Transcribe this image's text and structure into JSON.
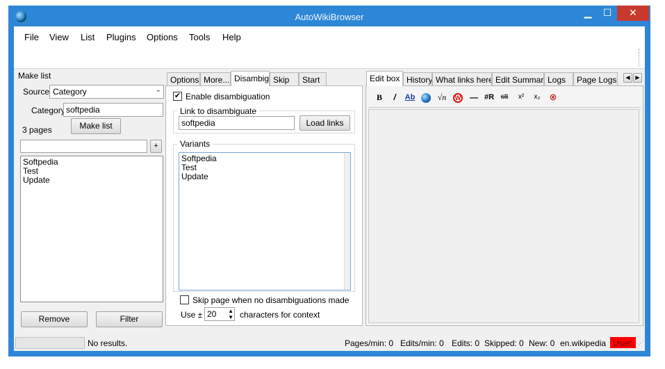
{
  "window": {
    "title": "AutoWikiBrowser"
  },
  "menu": [
    "File",
    "View",
    "List",
    "Plugins",
    "Options",
    "Tools",
    "Help"
  ],
  "make_list": {
    "heading": "Make list",
    "source_label": "Source:",
    "source_value": "Category",
    "category_label": "Category:",
    "category_value": "softpedia",
    "pages_count": "3 pages",
    "make_list_button": "Make list",
    "add_button": "+",
    "filter_input": "",
    "items": [
      "Softpedia",
      "Test",
      "Update"
    ],
    "remove_button": "Remove",
    "filter_button": "Filter"
  },
  "middle_tabs": [
    "Options",
    "More...",
    "Disambig",
    "Skip",
    "Start"
  ],
  "disambig": {
    "enable_label": "Enable disambiguation",
    "enable_checked": true,
    "link_group": "Link to disambiguate",
    "link_value": "softpedia",
    "load_links_button": "Load links",
    "variants_group": "Variants",
    "variants": [
      "Softpedia",
      "Test",
      "Update"
    ],
    "skip_label": "Skip page when no disambiguations made",
    "skip_checked": false,
    "use_label": "Use ±",
    "context_value": "20",
    "context_suffix": "characters for context"
  },
  "right_tabs": [
    "Edit box",
    "History",
    "What links here",
    "Edit Summary",
    "Logs",
    "Page Logs"
  ],
  "edit_toolbar": {
    "bold": "B",
    "italic": "/",
    "link": "Ab",
    "sqrt": "√n",
    "rule": "—",
    "redirect": "#R",
    "strike": "stt",
    "superscript": "x²",
    "subscript": "x₂"
  },
  "status": {
    "message": "No results.",
    "pages_per_min": "Pages/min: 0",
    "edits_per_min": "Edits/min: 0",
    "edits": "Edits: 0",
    "skipped": "Skipped: 0",
    "new": "New: 0",
    "project": "en.wikipedia",
    "user": "User:"
  },
  "colors": {
    "titlebar": "#2e86d6",
    "close": "#c7392c",
    "user_badge": "#ff0000"
  }
}
